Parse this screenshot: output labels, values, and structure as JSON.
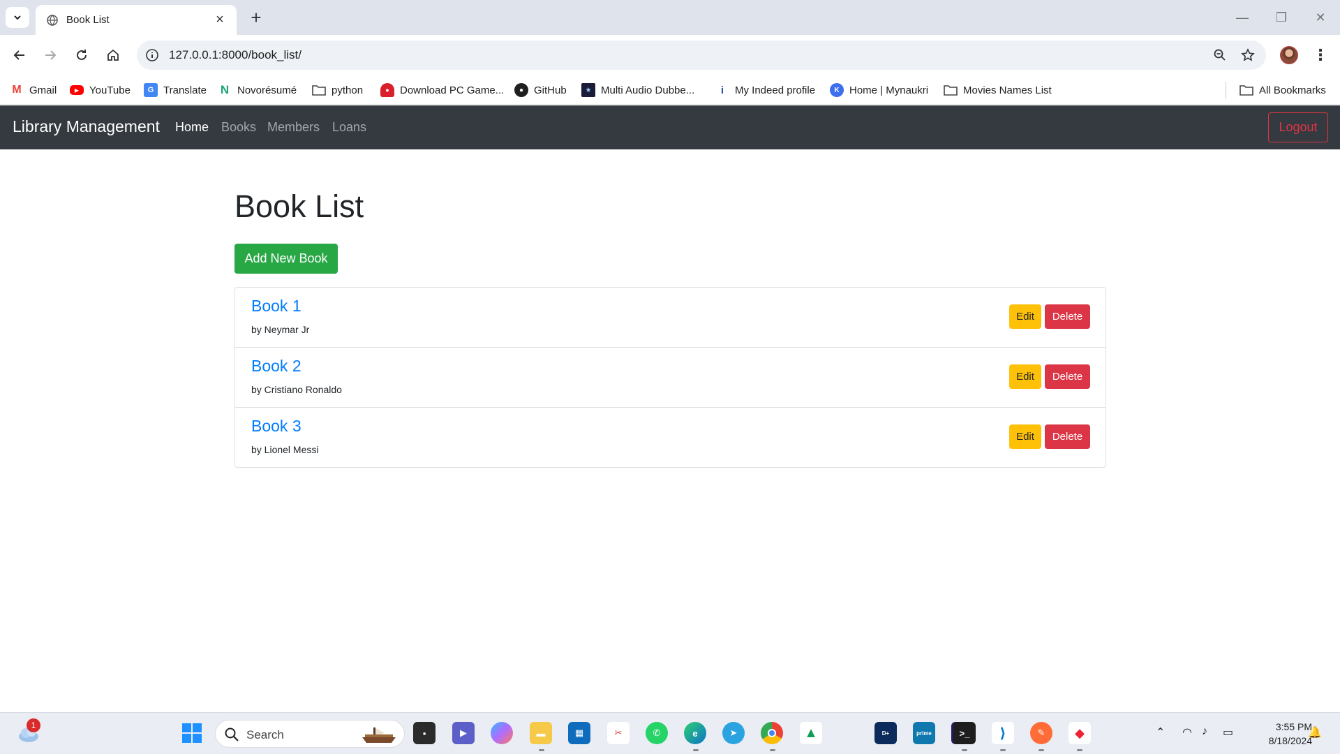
{
  "browser": {
    "tab_title": "Book List",
    "url": "127.0.0.1:8000/book_list/",
    "bookmarks": [
      {
        "label": "Gmail",
        "icon": "gmail-icon"
      },
      {
        "label": "YouTube",
        "icon": "youtube-icon"
      },
      {
        "label": "Translate",
        "icon": "translate-icon"
      },
      {
        "label": "Novorésumé",
        "icon": "novoresume-icon"
      },
      {
        "label": "python",
        "icon": "folder-icon"
      },
      {
        "label": "Download PC Game...",
        "icon": "game-icon"
      },
      {
        "label": "GitHub",
        "icon": "github-icon"
      },
      {
        "label": "Multi Audio Dubbe...",
        "icon": "movie-icon"
      },
      {
        "label": "My Indeed profile",
        "icon": "indeed-icon"
      },
      {
        "label": "Home | Mynaukri",
        "icon": "naukri-icon"
      },
      {
        "label": "Movies Names List",
        "icon": "folder-icon"
      }
    ],
    "all_bookmarks": "All Bookmarks"
  },
  "app": {
    "brand": "Library Management",
    "nav": [
      "Home",
      "Books",
      "Members",
      "Loans"
    ],
    "logout": "Logout",
    "page_title": "Book List",
    "add_button": "Add New Book",
    "books": [
      {
        "title": "Book 1",
        "author": "by Neymar Jr"
      },
      {
        "title": "Book 2",
        "author": "by Cristiano Ronaldo"
      },
      {
        "title": "Book 3",
        "author": "by Lionel Messi"
      }
    ],
    "edit_label": "Edit",
    "delete_label": "Delete"
  },
  "taskbar": {
    "search_placeholder": "Search",
    "weather_badge": "1",
    "time": "3:55 PM",
    "date": "8/18/2024"
  },
  "colors": {
    "navbar": "#343a40",
    "primary_link": "#007bff",
    "success": "#28a745",
    "warning": "#ffc107",
    "danger": "#dc3545"
  }
}
